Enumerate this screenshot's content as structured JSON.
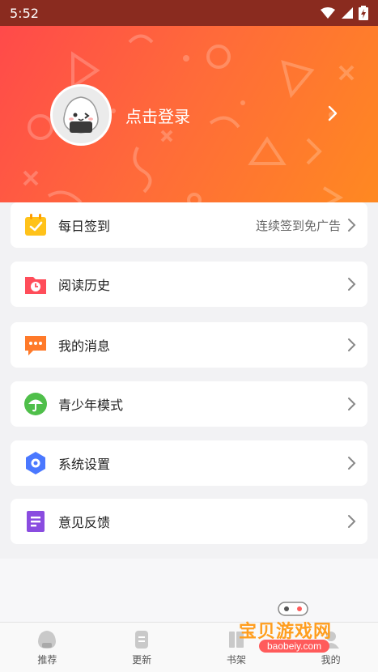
{
  "status_bar": {
    "time": "5:52",
    "icons": [
      "wifi-icon",
      "signal-icon",
      "battery-icon"
    ]
  },
  "profile": {
    "login_text": "点击登录",
    "avatar_icon": "rice-ball-avatar-icon"
  },
  "menu": [
    {
      "label": "每日签到",
      "extra": "连续签到免广告",
      "icon": "calendar-check-icon",
      "color": "#ffc21a"
    },
    {
      "label": "阅读历史",
      "extra": "",
      "icon": "history-folder-icon",
      "color": "#ff4d5a"
    },
    {
      "label": "我的消息",
      "extra": "",
      "icon": "message-icon",
      "color": "#ff7a2a"
    },
    {
      "label": "青少年模式",
      "extra": "",
      "icon": "umbrella-icon",
      "color": "#4fbf4a"
    },
    {
      "label": "系统设置",
      "extra": "",
      "icon": "settings-icon",
      "color": "#4a78ff"
    },
    {
      "label": "意见反馈",
      "extra": "",
      "icon": "feedback-icon",
      "color": "#8a4ce0"
    }
  ],
  "bottom_nav": [
    {
      "label": "推荐",
      "icon": "recommend-icon"
    },
    {
      "label": "更新",
      "icon": "update-icon"
    },
    {
      "label": "书架",
      "icon": "bookshelf-icon"
    },
    {
      "label": "我的",
      "icon": "profile-icon"
    }
  ],
  "watermark": {
    "text": "宝贝游戏网",
    "url": "baobeiy.com"
  },
  "colors": {
    "header_start": "#ff4a4a",
    "header_end": "#ff8a20",
    "background": "#f2f2f4"
  }
}
